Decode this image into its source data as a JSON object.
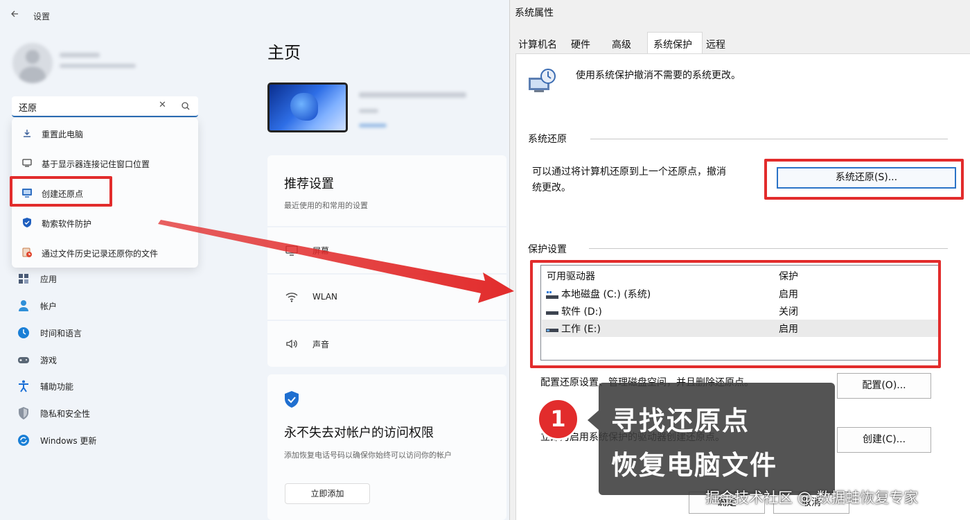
{
  "settings": {
    "app_title": "设置",
    "home_title": "主页",
    "search": {
      "value": "还原"
    },
    "results": [
      {
        "label": "重置此电脑",
        "icon": "reset-pc-icon"
      },
      {
        "label": "基于显示器连接记住窗口位置",
        "icon": "monitor-icon"
      },
      {
        "label": "创建还原点",
        "icon": "restore-point-icon"
      },
      {
        "label": "勒索软件防护",
        "icon": "shield-icon"
      },
      {
        "label": "通过文件历史记录还原你的文件",
        "icon": "file-history-icon"
      }
    ],
    "nav": [
      {
        "label": "应用",
        "icon": "apps-icon",
        "color": "#4a5b76"
      },
      {
        "label": "帐户",
        "icon": "account-icon",
        "color": "#2f8fd8"
      },
      {
        "label": "时间和语言",
        "icon": "time-language-icon",
        "color": "#1a7fd6"
      },
      {
        "label": "游戏",
        "icon": "gaming-icon",
        "color": "#5a6776"
      },
      {
        "label": "辅助功能",
        "icon": "accessibility-icon",
        "color": "#1a6fd6"
      },
      {
        "label": "隐私和安全性",
        "icon": "privacy-shield-icon",
        "color": "#6d7684"
      },
      {
        "label": "Windows 更新",
        "icon": "windows-update-icon",
        "color": "#1a7fd6"
      }
    ],
    "recommended": {
      "title": "推荐设置",
      "subtitle": "最近使用的和常用的设置"
    },
    "rows": [
      {
        "label": "屏幕",
        "icon": "display-icon"
      },
      {
        "label": "WLAN",
        "icon": "wifi-icon"
      },
      {
        "label": "声音",
        "icon": "sound-icon"
      }
    ],
    "account_card": {
      "title": "永不失去对帐户的访问权限",
      "description": "添加恢复电话号码以确保你始终可以访问你的帐户",
      "button": "立即添加"
    }
  },
  "dialog": {
    "title": "系统属性",
    "tabs": [
      "计算机名",
      "硬件",
      "高级",
      "系统保护",
      "远程"
    ],
    "active_tab": "系统保护",
    "intro": "使用系统保护撤消不需要的系统更改。",
    "restore_group": "系统还原",
    "restore_text_1": "可以通过将计算机还原到上一个还原点，撤消",
    "restore_text_2": "统更改。",
    "restore_button": "系统还原(S)...",
    "protection_group": "保护设置",
    "columns": [
      "可用驱动器",
      "保护"
    ],
    "drives": [
      {
        "name": "本地磁盘 (C:) (系统)",
        "protection": "启用",
        "icon": "system-drive-icon"
      },
      {
        "name": "软件 (D:)",
        "protection": "关闭",
        "icon": "drive-icon"
      },
      {
        "name": "工作 (E:)",
        "protection": "启用",
        "icon": "drive-icon"
      }
    ],
    "configure_text": "配置还原设置、管理磁盘空间，并且删除还原点。",
    "configure_button": "配置(O)...",
    "create_text": "立即为启用系统保护的驱动器创建还原点。",
    "create_button": "创建(C)...",
    "ok_button": "确定",
    "cancel_button": "取消"
  },
  "annotation": {
    "step": "1",
    "line1": "寻找还原点",
    "line2": "恢复电脑文件",
    "accent": "#e22c2c"
  },
  "watermark": "掘金技术社区 @ 数据蛙恢复专家"
}
